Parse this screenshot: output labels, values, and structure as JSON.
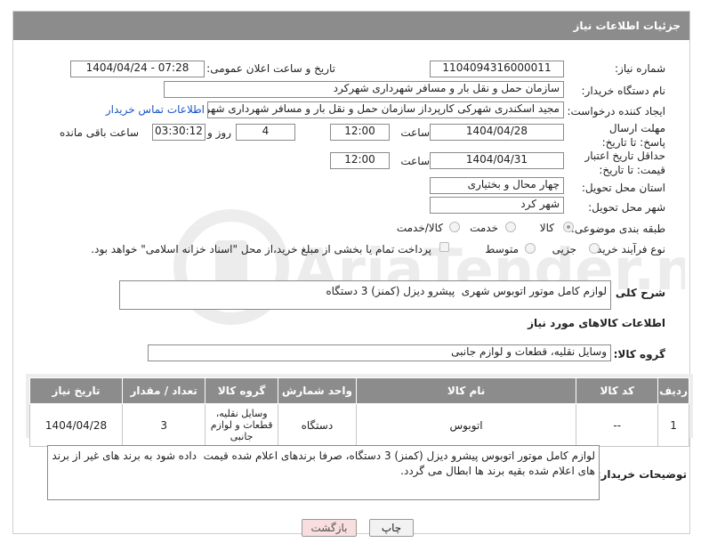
{
  "header": {
    "title": "جزئیات اطلاعات نیاز"
  },
  "fields": {
    "need_number_label": "شماره نیاز:",
    "need_number": "1104094316000011",
    "announce_label": "تاریخ و ساعت اعلان عمومی:",
    "announce_value": "1404/04/24 - 07:28",
    "buyer_label": "نام دستگاه خریدار:",
    "buyer_value": "سازمان حمل و نقل بار و مسافر شهرداری شهرکرد",
    "creator_label": "ایجاد کننده درخواست:",
    "creator_value": "مجید اسکندری شهرکی کارپرداز سازمان حمل و نقل بار و مسافر شهرداری شهر",
    "contact_link": "اطلاعات تماس خریدار",
    "deadline_label": "مهلت ارسال پاسخ: تا تاریخ:",
    "deadline_date": "1404/04/28",
    "time_label": "ساعت",
    "deadline_time": "12:00",
    "days_value": "4",
    "days_label": "روز و",
    "remaining_value": "03:30:12",
    "remaining_label": "ساعت باقی مانده",
    "validity_label": "حداقل تاریخ اعتبار قیمت: تا تاریخ:",
    "validity_date": "1404/04/31",
    "validity_time": "12:00",
    "province_label": "استان محل تحویل:",
    "province_value": "چهار محال و بختیاری",
    "city_label": "شهر محل تحویل:",
    "city_value": "شهر کرد",
    "category_label": "طبقه بندی موضوعی:",
    "category_options": [
      "کالا",
      "خدمت",
      "کالا/خدمت"
    ],
    "category_selected": "کالا",
    "process_label": "نوع فرآیند خرید :",
    "process_options": [
      "جزیی",
      "متوسط"
    ],
    "payment_note": "پرداخت تمام یا بخشی از مبلغ خرید،از محل \"اسناد خزانه اسلامی\" خواهد بود."
  },
  "description": {
    "label": "شرح کلی نیاز:",
    "value": "لوازم کامل موتور اتوبوس شهری  پیشرو دیزل (کمنز) 3 دستگاه"
  },
  "goods": {
    "section_title": "اطلاعات کالاهای مورد نیاز",
    "group_label": "گروه کالا:",
    "group_value": "وسایل نقلیه، قطعات و لوازم جانبی"
  },
  "table": {
    "headers": [
      "ردیف",
      "کد کالا",
      "نام کالا",
      "واحد شمارش",
      "گروه کالا",
      "تعداد / مقدار",
      "تاریخ نیاز"
    ],
    "rows": [
      [
        "1",
        "--",
        "اتوبوس",
        "دستگاه",
        "وسایل نقلیه، قطعات و لوازم جانبی",
        "3",
        "1404/04/28"
      ]
    ]
  },
  "buyer_notes": {
    "label": "توضیحات خریدار:",
    "value": "لوازم کامل موتور اتوبوس پیشرو دیزل (کمنز) 3 دستگاه، صرفا برندهای اعلام شده قیمت  داده شود به برند های غیر از برند های اعلام شده بقیه برند ها ابطال می گردد."
  },
  "buttons": {
    "print": "چاپ",
    "back": "بازگشت"
  },
  "watermark": "AriaTender.net",
  "colors": {
    "header_bg": "#8c8c8c",
    "link": "#1a56c8",
    "back_button_bg": "#f8dede"
  }
}
